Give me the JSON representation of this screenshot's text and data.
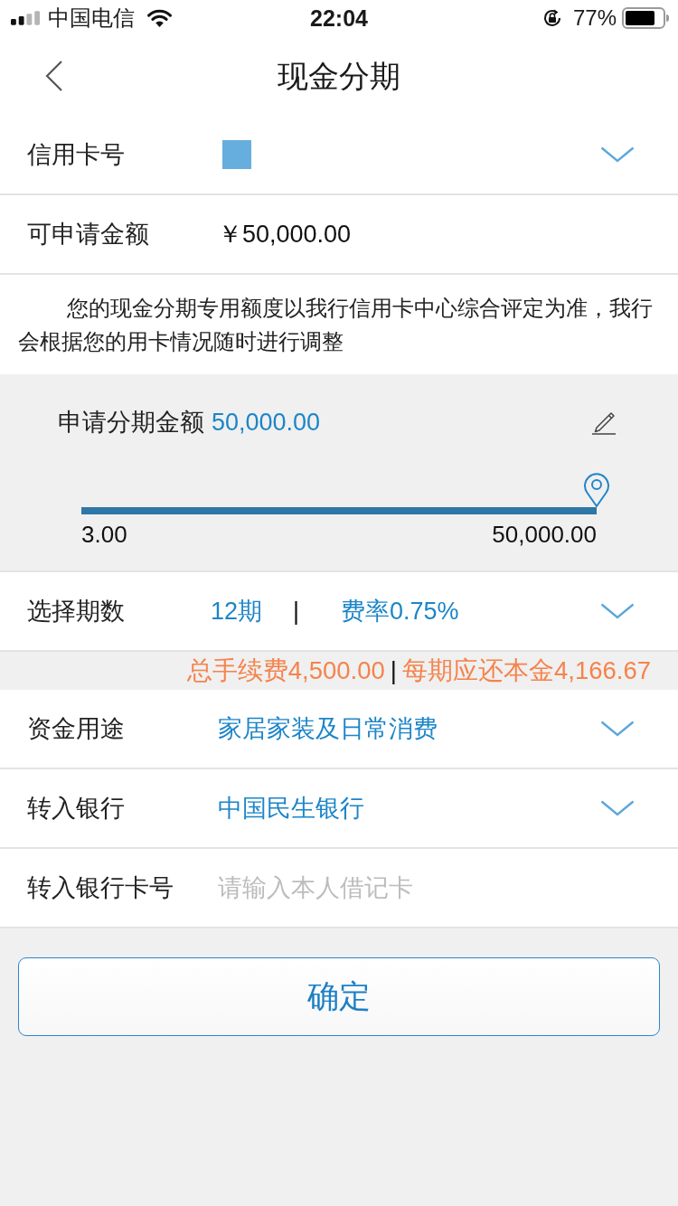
{
  "status_bar": {
    "carrier": "中国电信",
    "time": "22:04",
    "battery": "77%"
  },
  "nav": {
    "title": "现金分期"
  },
  "card_row": {
    "label": "信用卡号"
  },
  "available_row": {
    "label": "可申请金额",
    "value": "￥50,000.00"
  },
  "notice": "您的现金分期专用额度以我行信用卡中心综合评定为准，我行会根据您的用卡情况随时进行调整",
  "amount": {
    "label": "申请分期金额",
    "value": "50,000.00",
    "slider": {
      "level": 1,
      "min_label": "3.00",
      "max_label": "50,000.00"
    }
  },
  "term_row": {
    "label": "选择期数",
    "term": "12期",
    "separator": "|",
    "rate": "费率0.75%"
  },
  "summary": {
    "fee": "总手续费4,500.00",
    "separator": "|",
    "principal": "每期应还本金4,166.67"
  },
  "fields": [
    {
      "kind": "select",
      "label": "资金用途",
      "value": "家居家装及日常消费"
    },
    {
      "kind": "select",
      "label": "转入银行",
      "value": "中国民生银行"
    },
    {
      "kind": "input",
      "label": "转入银行卡号",
      "placeholder": "请输入本人借记卡"
    }
  ],
  "confirm_button": "确定"
}
